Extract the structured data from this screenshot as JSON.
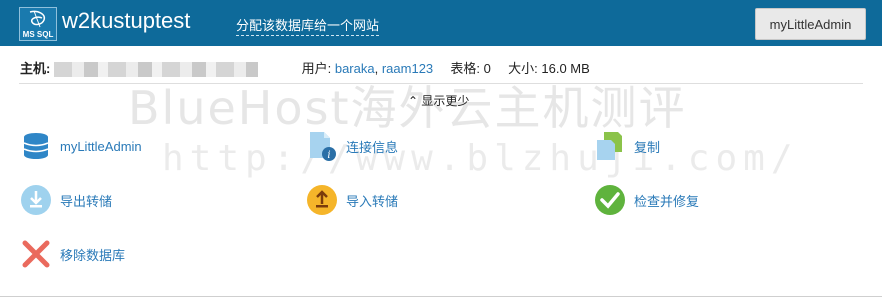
{
  "header": {
    "logo_text": "MS SQL",
    "title": "w2kustuptest",
    "assign_link": "分配该数据库给一个网站",
    "mla_button": "myLittleAdmin"
  },
  "info": {
    "host_label": "主机:",
    "users_label": "用户:",
    "user1": "baraka",
    "sep": ",",
    "user2": "raam123",
    "tables_label": "表格:",
    "tables_value": "0",
    "size_label": "大小:",
    "size_value": "16.0 MB"
  },
  "toggle": {
    "arrow": "⌃",
    "label": "显示更少"
  },
  "watermark": {
    "line1": "BlueHost海外云主机测评",
    "line2": "http://www.blzhuji.com/"
  },
  "actions": {
    "mla": "myLittleAdmin",
    "conn": "连接信息",
    "copy": "复制",
    "export": "导出转储",
    "import": "导入转储",
    "check": "检查并修复",
    "remove": "移除数据库"
  },
  "colors": {
    "header_bg": "#0e6a9a",
    "link": "#2a7ab8",
    "check_green": "#5fb33d",
    "import_orange": "#f5b52a",
    "remove_red": "#ea6a5d"
  }
}
